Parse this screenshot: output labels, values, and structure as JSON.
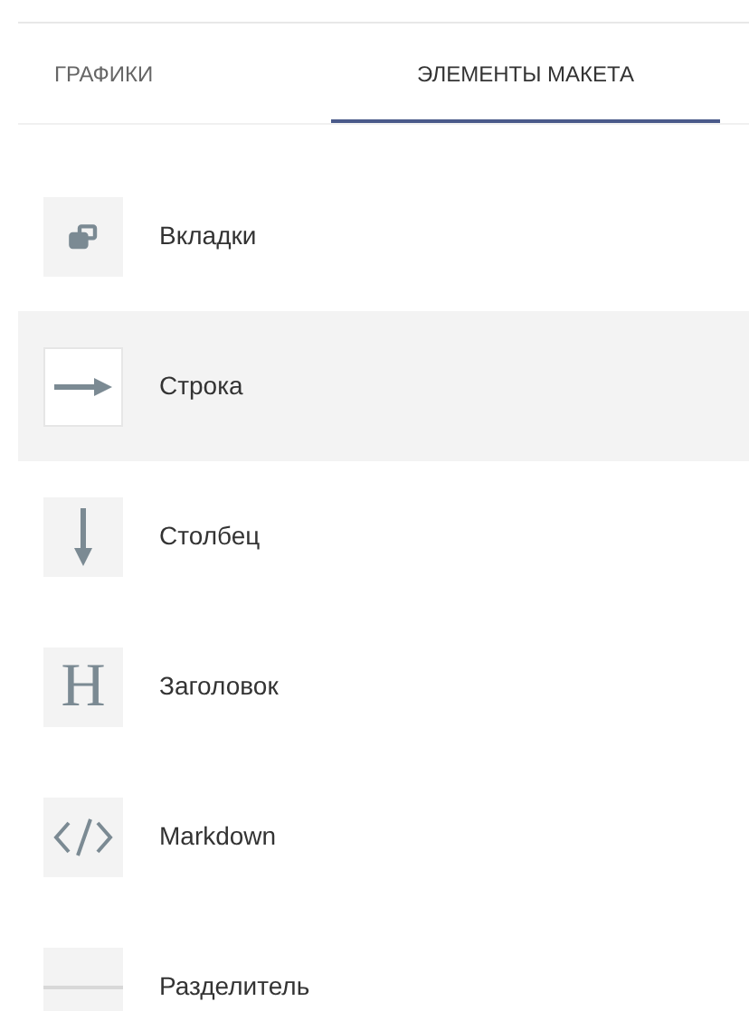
{
  "tabs": [
    {
      "label": "ГРАФИКИ",
      "selected": false
    },
    {
      "label": "ЭЛЕМЕНТЫ МАКЕТА",
      "selected": true
    }
  ],
  "items": [
    {
      "kind": "tabs",
      "label": "Вкладки",
      "selected": false
    },
    {
      "kind": "row",
      "label": "Строка",
      "selected": true
    },
    {
      "kind": "column",
      "label": "Столбец",
      "selected": false
    },
    {
      "kind": "header",
      "label": "Заголовок",
      "glyph": "H",
      "selected": false
    },
    {
      "kind": "markdown",
      "label": "Markdown",
      "selected": false
    },
    {
      "kind": "divider",
      "label": "Разделитель",
      "selected": false
    }
  ]
}
